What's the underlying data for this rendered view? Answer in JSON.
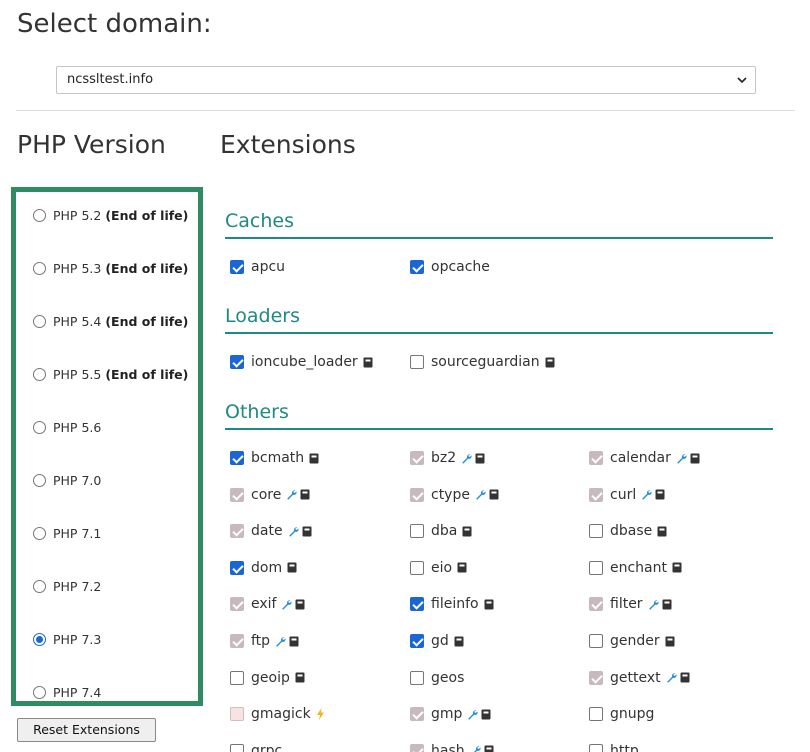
{
  "title": "Select domain:",
  "domain": {
    "selected": "ncssltest.info"
  },
  "php_heading": "PHP Version",
  "ext_heading": "Extensions",
  "php_versions": [
    {
      "label": "PHP 5.2",
      "note": "(End of life)",
      "selected": false
    },
    {
      "label": "PHP 5.3",
      "note": "(End of life)",
      "selected": false
    },
    {
      "label": "PHP 5.4",
      "note": "(End of life)",
      "selected": false
    },
    {
      "label": "PHP 5.5",
      "note": "(End of life)",
      "selected": false
    },
    {
      "label": "PHP 5.6",
      "note": "",
      "selected": false
    },
    {
      "label": "PHP 7.0",
      "note": "",
      "selected": false
    },
    {
      "label": "PHP 7.1",
      "note": "",
      "selected": false
    },
    {
      "label": "PHP 7.2",
      "note": "",
      "selected": false
    },
    {
      "label": "PHP 7.3",
      "note": "",
      "selected": true
    },
    {
      "label": "PHP 7.4",
      "note": "",
      "selected": false
    }
  ],
  "reset_label": "Reset Extensions",
  "colors": {
    "accent": "#1e8a80",
    "border": "#2e8b62",
    "check": "#1a66d4",
    "wrench": "#2a8fd6",
    "bolt": "#f0b429"
  },
  "sections": [
    {
      "title": "Caches",
      "items": [
        {
          "name": "apcu",
          "state": "checked",
          "icons": []
        },
        {
          "name": "opcache",
          "state": "checked",
          "icons": []
        }
      ]
    },
    {
      "title": "Loaders",
      "items": [
        {
          "name": "ioncube_loader",
          "state": "checked",
          "icons": [
            "book-icon"
          ]
        },
        {
          "name": "sourceguardian",
          "state": "unchecked",
          "icons": [
            "book-icon"
          ]
        }
      ]
    },
    {
      "title": "Others",
      "items": [
        {
          "name": "bcmath",
          "state": "checked",
          "icons": [
            "book-icon"
          ]
        },
        {
          "name": "bz2",
          "state": "locked",
          "icons": [
            "wrench-icon",
            "book-icon"
          ]
        },
        {
          "name": "calendar",
          "state": "locked",
          "icons": [
            "wrench-icon",
            "book-icon"
          ]
        },
        {
          "name": "core",
          "state": "locked",
          "icons": [
            "wrench-icon",
            "book-icon"
          ]
        },
        {
          "name": "ctype",
          "state": "locked",
          "icons": [
            "wrench-icon",
            "book-icon"
          ]
        },
        {
          "name": "curl",
          "state": "locked",
          "icons": [
            "wrench-icon",
            "book-icon"
          ]
        },
        {
          "name": "date",
          "state": "locked",
          "icons": [
            "wrench-icon",
            "book-icon"
          ]
        },
        {
          "name": "dba",
          "state": "unchecked",
          "icons": [
            "book-icon"
          ]
        },
        {
          "name": "dbase",
          "state": "unchecked",
          "icons": [
            "book-icon"
          ]
        },
        {
          "name": "dom",
          "state": "checked",
          "icons": [
            "book-icon"
          ]
        },
        {
          "name": "eio",
          "state": "unchecked",
          "icons": [
            "book-icon"
          ]
        },
        {
          "name": "enchant",
          "state": "unchecked",
          "icons": [
            "book-icon"
          ]
        },
        {
          "name": "exif",
          "state": "locked",
          "icons": [
            "wrench-icon",
            "book-icon"
          ]
        },
        {
          "name": "fileinfo",
          "state": "checked",
          "icons": [
            "book-icon"
          ]
        },
        {
          "name": "filter",
          "state": "locked",
          "icons": [
            "wrench-icon",
            "book-icon"
          ]
        },
        {
          "name": "ftp",
          "state": "locked",
          "icons": [
            "wrench-icon",
            "book-icon"
          ]
        },
        {
          "name": "gd",
          "state": "checked",
          "icons": [
            "book-icon"
          ]
        },
        {
          "name": "gender",
          "state": "unchecked",
          "icons": [
            "book-icon"
          ]
        },
        {
          "name": "geoip",
          "state": "unchecked",
          "icons": [
            "book-icon"
          ]
        },
        {
          "name": "geos",
          "state": "unchecked",
          "icons": []
        },
        {
          "name": "gettext",
          "state": "locked",
          "icons": [
            "wrench-icon",
            "book-icon"
          ]
        },
        {
          "name": "gmagick",
          "state": "partial",
          "icons": [
            "bolt-icon"
          ]
        },
        {
          "name": "gmp",
          "state": "locked",
          "icons": [
            "wrench-icon",
            "book-icon"
          ]
        },
        {
          "name": "gnupg",
          "state": "unchecked",
          "icons": []
        },
        {
          "name": "grpc",
          "state": "unchecked",
          "icons": []
        },
        {
          "name": "hash",
          "state": "locked",
          "icons": [
            "wrench-icon",
            "book-icon"
          ]
        },
        {
          "name": "http",
          "state": "unchecked",
          "icons": []
        }
      ]
    }
  ]
}
